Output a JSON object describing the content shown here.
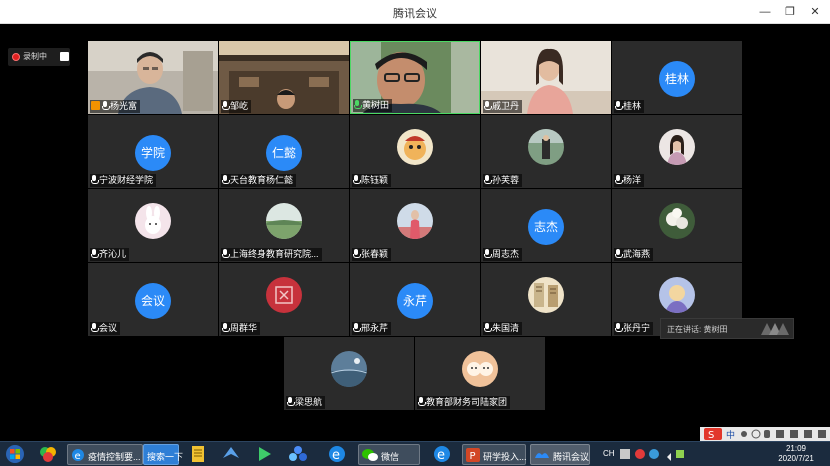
{
  "window": {
    "title": "腾讯会议"
  },
  "recording": {
    "label": "录制中"
  },
  "speaking": {
    "text": "正在讲话: 黄树田"
  },
  "tiles": [
    {
      "name": "杨光富",
      "kind": "video",
      "mic": "host"
    },
    {
      "name": "邹屹",
      "kind": "video",
      "mic": "off"
    },
    {
      "name": "黄树田",
      "kind": "video",
      "mic": "green"
    },
    {
      "name": "戚卫丹",
      "kind": "video",
      "mic": "off"
    },
    {
      "name": "桂林",
      "kind": "text",
      "avatar": "桂林",
      "mic": "off"
    },
    {
      "name": "宁波财经学院",
      "kind": "text",
      "avatar": "学院",
      "mic": "off"
    },
    {
      "name": "天台教育杨仁懿",
      "kind": "text",
      "avatar": "仁懿",
      "mic": "off"
    },
    {
      "name": "陈钰颖",
      "kind": "img",
      "mic": "off"
    },
    {
      "name": "孙芙蓉",
      "kind": "img",
      "mic": "off"
    },
    {
      "name": "杨洋",
      "kind": "img",
      "mic": "off"
    },
    {
      "name": "齐沁儿",
      "kind": "img",
      "mic": "off"
    },
    {
      "name": "上海终身教育研究院...",
      "kind": "img",
      "mic": "off"
    },
    {
      "name": "张春颖",
      "kind": "img",
      "mic": "off"
    },
    {
      "name": "周志杰",
      "kind": "text",
      "avatar": "志杰",
      "mic": "off"
    },
    {
      "name": "武海燕",
      "kind": "img",
      "mic": "off"
    },
    {
      "name": "会议",
      "kind": "text",
      "avatar": "会议",
      "mic": "off"
    },
    {
      "name": "周群华",
      "kind": "img",
      "mic": "off"
    },
    {
      "name": "邢永芹",
      "kind": "text",
      "avatar": "永芹",
      "mic": "off"
    },
    {
      "name": "朱国清",
      "kind": "img",
      "mic": "off"
    },
    {
      "name": "张丹宁",
      "kind": "img",
      "mic": "off"
    },
    {
      "name": "梁思航",
      "kind": "img",
      "mic": "off"
    },
    {
      "name": "教育部财务司陆家团",
      "kind": "img",
      "mic": "off"
    }
  ],
  "taskbar": {
    "browser_label": "疫情控制要...",
    "search_label": "搜索一下",
    "wechat_label": "微信",
    "ppt_label": "研学投入...",
    "meeting_label": "腾讯会议",
    "ime_label": "CH",
    "time": "21:09",
    "date": "2020/7/21"
  },
  "colors": {
    "avatar_blue": "#2b8af7",
    "host_orange": "#f39200",
    "speaking_green": "#4cd964"
  }
}
